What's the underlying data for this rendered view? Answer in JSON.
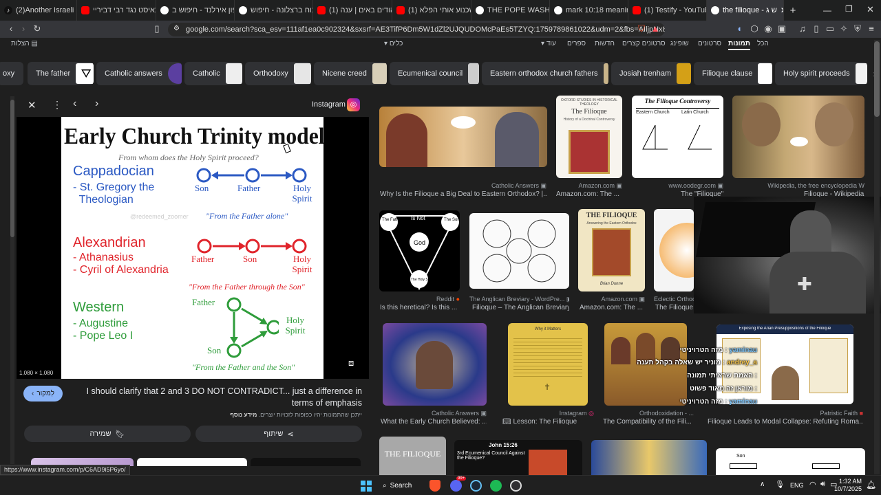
{
  "tabs": [
    {
      "title": "(2)Another Israeli Cl",
      "fav_color": "#000000",
      "fav_text": "♪"
    },
    {
      "title": "אתאיסט נגד רבי דביריי",
      "fav_color": "#ff0000",
      "fav_text": "▶"
    },
    {
      "title": "עפון אירלנד - חיפוש ב",
      "fav_color": "#ffffff",
      "fav_text": "G"
    },
    {
      "title": "ויכוח ברצלונה - חיפוש",
      "fav_color": "#ffffff",
      "fav_text": "G"
    },
    {
      "title": "(1) היהודים באים | ענה",
      "fav_color": "#ff0000",
      "fav_text": "▶"
    },
    {
      "title": "(1) שכנוע אותי הפלא",
      "fav_color": "#ff0000",
      "fav_text": "▶"
    },
    {
      "title": "THE POPE WASH FIT II",
      "fav_color": "#ffffff",
      "fav_text": "G"
    },
    {
      "title": "mark 10:18 meaning",
      "fav_color": "#ffffff",
      "fav_text": "G"
    },
    {
      "title": "(1) Testify - YouTube",
      "fav_color": "#ff0000",
      "fav_text": "▶"
    },
    {
      "title": "the filioque - ש ג",
      "fav_color": "#ffffff",
      "fav_text": "G"
    }
  ],
  "omnibox": {
    "url": "google.com/search?sca_esv=111af1ea0c902324&sxsrf=AE3TifP6Dm5W1dZl2UJQUDOMcPaEs5TZYQ:1759789861022&udm=2&fbs=AIljpHx8j6mn-bWde..."
  },
  "google_tabs": {
    "items": [
      "הכל",
      "תמונות",
      "סרטונים",
      "שופינג",
      "סרטונים קצרים",
      "חדשות",
      "ספרים",
      "עוד"
    ],
    "tools": "כלים",
    "safe_search": "הצלות"
  },
  "chips": [
    {
      "label": "oxy",
      "color": "#777777"
    },
    {
      "label": "The father",
      "color": "#ffffff"
    },
    {
      "label": "Catholic answers",
      "color": "#5b3fa0"
    },
    {
      "label": "Catholic",
      "color": "#eeeeee"
    },
    {
      "label": "Orthodoxy",
      "color": "#e6e6e6"
    },
    {
      "label": "Nicene creed",
      "color": "#d8cfb8"
    },
    {
      "label": "Ecumenical council",
      "color": "#cccccc"
    },
    {
      "label": "Eastern orthodox church fathers",
      "color": "#c9b48a"
    },
    {
      "label": "Josiah trenham",
      "color": "#d4a017"
    },
    {
      "label": "Filioque clause",
      "color": "#ffffff"
    },
    {
      "label": "Holy spirit proceeds",
      "color": "#f2f2f2"
    }
  ],
  "panel": {
    "source": "Instagram",
    "dimensions": "1,080 × 1,080",
    "visit_button": "לִמקור",
    "caption": "I should clarify that 2 and 3 DO NOT CONTRADICT... just a difference in terms of emphasis",
    "notice": "ייתכן שהתמונות יהיו כפופות לזכויות יוצרים.",
    "notice_link": "מידע נוסף",
    "save_button": "שמירה",
    "share_button": "שיתוף",
    "slide": {
      "title": "Early Church Trinity models",
      "subtitle": "From whom does the Holy Spirit proceed?",
      "watermark": "@redeemed_zoomer",
      "groups": [
        {
          "name": "Cappadocian",
          "members": [
            "- St. Gregory the",
            "  Theologian"
          ],
          "quote": "\"From the Father alone\"",
          "labels": [
            "Son",
            "Father",
            "Holy Spirit"
          ]
        },
        {
          "name": "Alexandrian",
          "members": [
            "- Athanasius",
            "- Cyril of Alexandria"
          ],
          "quote": "\"From the Father through the Son\"",
          "labels": [
            "Father",
            "Son",
            "Holy Spirit"
          ]
        },
        {
          "name": "Western",
          "members": [
            "- Augustine",
            "- Pope Leo I"
          ],
          "quote": "\"From the Father and the Son\"",
          "labels": [
            "Father",
            "Holy Spirit",
            "Son"
          ]
        }
      ]
    }
  },
  "results": [
    {
      "caption": "Why Is the Filioque a Big Deal to Eastern Orthodox? |...",
      "source": "Catholic Answers"
    },
    {
      "caption": "Amazon.com: The ...",
      "source": "Amazon.com"
    },
    {
      "caption": "The \"Filioque\"",
      "source": "www.oodegr.com"
    },
    {
      "caption": "Filioque - Wikipedia",
      "source": "Wikipedia, the free encyclopedia"
    },
    {
      "caption": "Is this heretical? Is this ...",
      "source": "Reddit"
    },
    {
      "caption": "Filioque – The Anglican Breviary",
      "source": "The Anglican Breviary - WordPre..."
    },
    {
      "caption": "Amazon.com: The ...",
      "source": "Amazon.com"
    },
    {
      "caption": "The Filioque",
      "source": "Eclectic Orthod..."
    },
    {
      "caption": "What the Early Church Believed: ...",
      "source": "Catholic Answers"
    },
    {
      "caption": "Lesson: The Filioque",
      "source": "Instagram"
    },
    {
      "caption": "The Compatibility of the Fili...",
      "source": "Orthodoxidation - ..."
    },
    {
      "caption": "Filioque Leads to Modal Collapse: Refuting Roma...",
      "source": "Patristic Faith"
    }
  ],
  "thumb_texts": {
    "filioque_book": "The Filioque",
    "filioque_book_sub": "History of a Doctrinal Controversy",
    "oxford": "OXFORD STUDIES IN HISTORICAL THEOLOGY",
    "controversy_title": "The Filioque Controversy",
    "eastern": "Eastern Church",
    "latin": "Latin Church",
    "shield": [
      "The Father",
      "Is Not",
      "The Son",
      "God",
      "Is",
      "The Holy Spirit"
    ],
    "amazon_book": "THE FILIOQUE",
    "amazon_book_sub": "Answering the Eastern Orthodox",
    "amazon_author": "Brian Dunne",
    "lesson_title": "Why it Matters",
    "arian": "Exposing the Arian Presuppositions of the Filioque",
    "gray_book": "THE FILIOQUE",
    "john": "John 15:26",
    "council": "3rd Ecumenical Council Against the Filioque?",
    "son": "Son"
  },
  "chat_overlay": [
    {
      "user": "yaminau",
      "text": "מזה הטרויניטי :"
    },
    {
      "user": "andrey_a",
      "text": "מוניר יש שאלה בקהל תענה :"
    },
    {
      "user": "",
      "text": "האמת שראיתי תמונה :"
    },
    {
      "user": "",
      "text": "מוראן זה מאוד פשוט :"
    },
    {
      "user": "yaminau",
      "text": "מזה הטרויניטי :"
    }
  ],
  "status_url": "https://www.instagram.com/p/C6AD9i5P6yo/",
  "taskbar": {
    "search": "Search",
    "lang": "ENG",
    "time": "1:32 AM",
    "date": "10/7/2025",
    "discord_badge": "99+"
  }
}
